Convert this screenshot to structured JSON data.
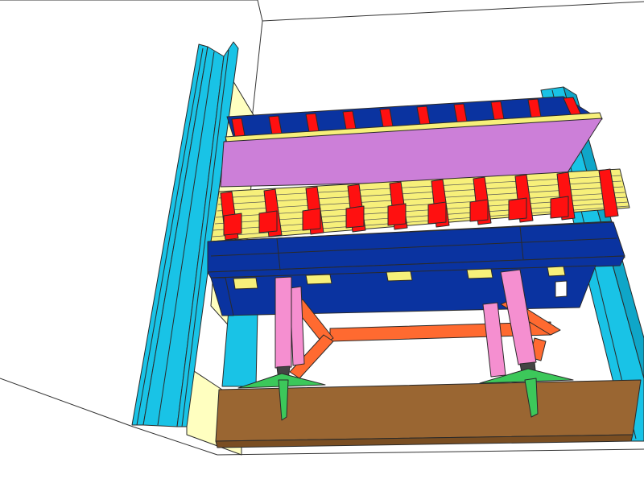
{
  "scene": {
    "view": "isometric-3d-structural-model",
    "components": [
      "room-walls",
      "left-column",
      "right-column",
      "yellow-panel",
      "upper-beam-grid",
      "purple-plate",
      "lower-beam-grid",
      "blue-main-girder",
      "pink-props",
      "orange-bracing",
      "green-base-plates",
      "brown-base-beam"
    ]
  },
  "colors": {
    "column": "#19c3e6",
    "panel": "#ffffc0",
    "girder": "#0a33a0",
    "beam": "#ff1010",
    "plate": "#cc7fd8",
    "deck": "#f7f07a",
    "prop": "#f58fd0",
    "brace": "#ff6a30",
    "base_plate": "#3cc85a",
    "base_beam": "#9a6632",
    "outline": "#2a2a2a"
  }
}
